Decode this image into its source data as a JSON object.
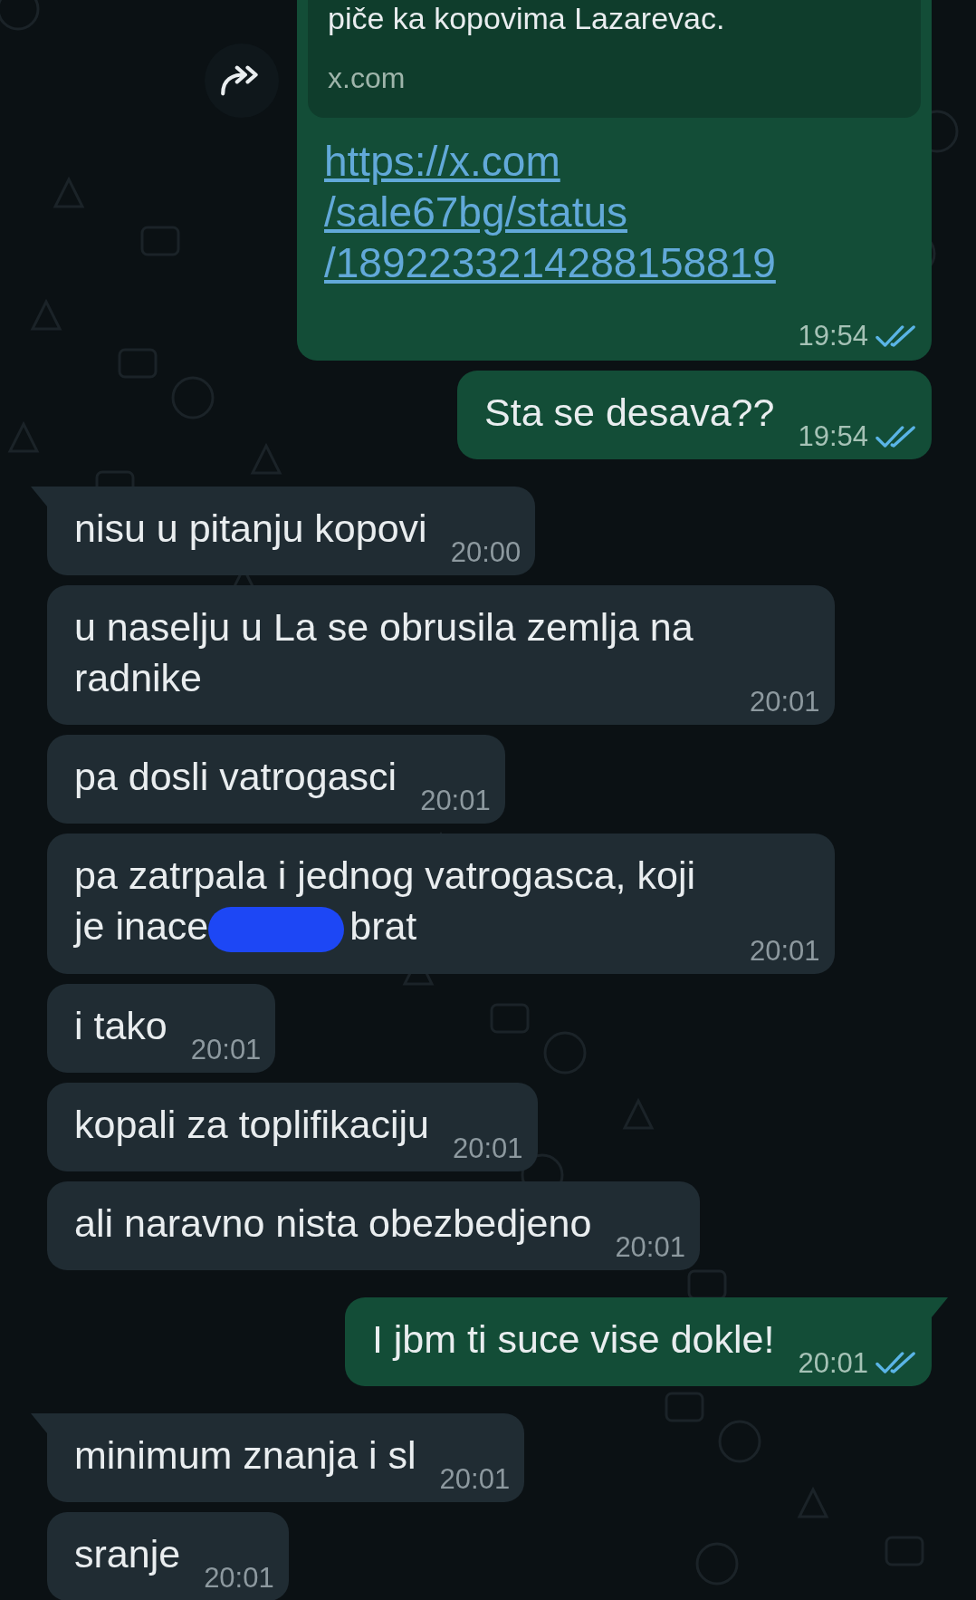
{
  "messages": [
    {
      "outgoing": true,
      "kind": "link",
      "forwarded": true,
      "tail": false,
      "preview_text": "piče ka kopovima Lazarevac.",
      "preview_domain": "x.com",
      "link": "https://x.com/sale67bg/status/1892233214288158819",
      "time": "19:54",
      "read": true
    },
    {
      "outgoing": true,
      "kind": "text",
      "tail": false,
      "text": "Sta se desava??",
      "time": "19:54",
      "read": true
    },
    {
      "outgoing": false,
      "kind": "text",
      "tail": true,
      "text": "nisu u pitanju kopovi",
      "time": "20:00"
    },
    {
      "outgoing": false,
      "kind": "text",
      "tail": false,
      "text": "u naselju u La se obrusila zemlja na radnike",
      "time": "20:01"
    },
    {
      "outgoing": false,
      "kind": "text",
      "tail": false,
      "text": "pa dosli vatrogasci",
      "time": "20:01"
    },
    {
      "outgoing": false,
      "kind": "text",
      "tail": false,
      "text": "pa zatrpala i jednog vatrogasca, koji je inace",
      "redacted": true,
      "text_after": "brat",
      "time": "20:01"
    },
    {
      "outgoing": false,
      "kind": "text",
      "tail": false,
      "text": "i tako",
      "time": "20:01"
    },
    {
      "outgoing": false,
      "kind": "text",
      "tail": false,
      "text": "kopali za toplifikaciju",
      "time": "20:01"
    },
    {
      "outgoing": false,
      "kind": "text",
      "tail": false,
      "text": "ali naravno nista obezbedjeno",
      "time": "20:01"
    },
    {
      "outgoing": true,
      "kind": "text",
      "tail": true,
      "text": "I jbm ti suce vise dokle!",
      "time": "20:01",
      "read": true
    },
    {
      "outgoing": false,
      "kind": "text",
      "tail": true,
      "text": "minimum znanja i sl",
      "time": "20:01"
    },
    {
      "outgoing": false,
      "kind": "text",
      "tail": false,
      "text": "sranje",
      "time": "20:01"
    }
  ]
}
